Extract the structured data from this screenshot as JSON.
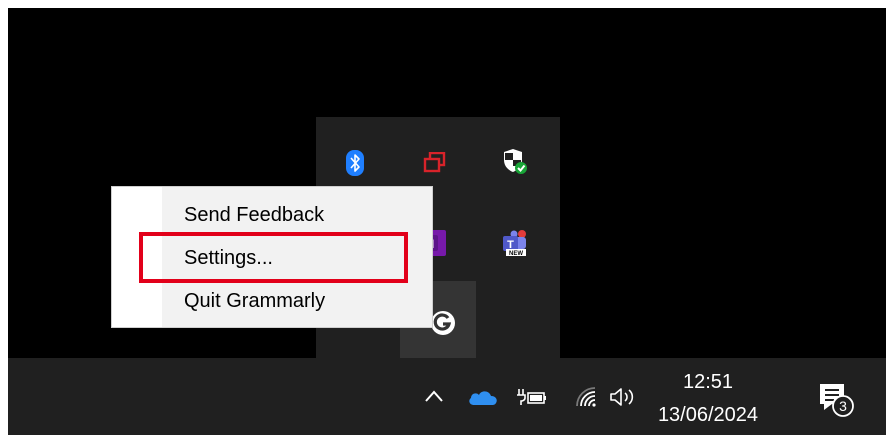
{
  "context_menu": {
    "items": [
      {
        "label": "Send Feedback"
      },
      {
        "label": "Settings..."
      },
      {
        "label": "Quit Grammarly"
      }
    ]
  },
  "tray_overflow": {
    "icons": [
      "bluetooth-icon",
      "remote-desktop-icon",
      "windows-security-icon",
      "onenote-icon",
      "teams-new-icon",
      "grammarly-icon"
    ],
    "teams_badge_text": "NEW",
    "onenote_letter": "N"
  },
  "taskbar": {
    "time": "12:51",
    "date": "13/06/2024",
    "notification_count": "3",
    "icons": [
      "show-hidden-icons-chevron",
      "onedrive-icon",
      "battery-charging-icon",
      "wifi-icon",
      "volume-icon",
      "notification-center-icon"
    ]
  },
  "colors": {
    "highlight": "#e2001a",
    "bluetooth": "#1f7fff",
    "remote": "#d8232a",
    "onenote": "#7719aa",
    "teams": "#5059c9",
    "onedrive": "#2f8ff0",
    "security_check": "#18a537"
  }
}
